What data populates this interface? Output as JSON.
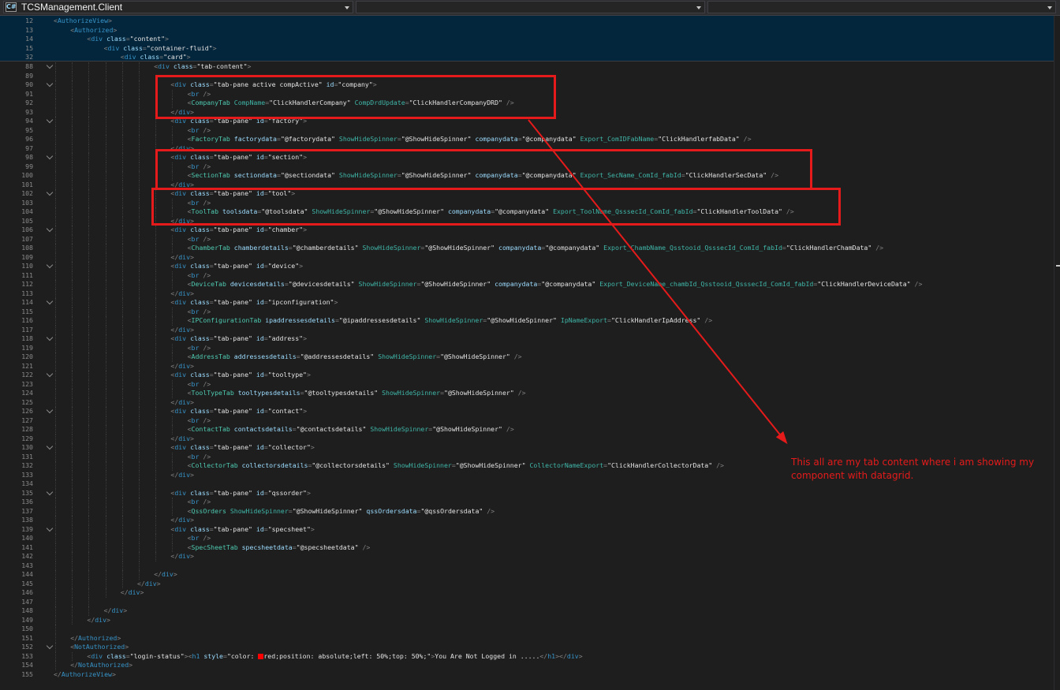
{
  "window": {
    "project_dropdown": "TCSManagement.Client",
    "project_icon": "C#"
  },
  "sticky_lines": [
    {
      "num": "12",
      "text": "<AuthorizeView>"
    },
    {
      "num": "13",
      "text": "<Authorized>"
    },
    {
      "num": "14",
      "text": "<div class=\"content\">"
    },
    {
      "num": "15",
      "text": "<div class=\"container-fluid\">"
    },
    {
      "num": "32",
      "text": "<div class=\"card\">"
    }
  ],
  "code_lines": [
    {
      "num": "88",
      "text": "<div class=\"tab-content\">"
    },
    {
      "num": "89",
      "text": ""
    },
    {
      "num": "90",
      "text": "<div class=\"tab-pane active compActive\" id=\"company\">"
    },
    {
      "num": "91",
      "text": "<br />"
    },
    {
      "num": "92",
      "text": "<CompanyTab CompName=\"ClickHandlerCompany\" CompDrdUpdate=\"ClickHandlerCompanyDRD\" />"
    },
    {
      "num": "93",
      "text": "</div>"
    },
    {
      "num": "94",
      "text": "<div class=\"tab-pane\" id=\"factory\">"
    },
    {
      "num": "95",
      "text": "<br />"
    },
    {
      "num": "96",
      "text": "<FactoryTab factorydata=\"@factorydata\" ShowHideSpinner=\"@ShowHideSpinner\" companydata=\"@companydata\" Export_ComIDFabName=\"ClickHandlerfabData\" />"
    },
    {
      "num": "97",
      "text": "</div>"
    },
    {
      "num": "98",
      "text": "<div class=\"tab-pane\" id=\"section\">"
    },
    {
      "num": "99",
      "text": "<br />"
    },
    {
      "num": "100",
      "text": "<SectionTab sectiondata=\"@sectiondata\" ShowHideSpinner=\"@ShowHideSpinner\" companydata=\"@companydata\" Export_SecName_ComId_fabId=\"ClickHandlerSecData\" />"
    },
    {
      "num": "101",
      "text": "</div>"
    },
    {
      "num": "102",
      "text": "<div class=\"tab-pane\" id=\"tool\">"
    },
    {
      "num": "103",
      "text": "<br />"
    },
    {
      "num": "104",
      "text": "<ToolTab toolsdata=\"@toolsdata\" ShowHideSpinner=\"@ShowHideSpinner\" companydata=\"@companydata\" Export_ToolName_QsssecId_ComId_fabId=\"ClickHandlerToolData\" />"
    },
    {
      "num": "105",
      "text": "</div>"
    },
    {
      "num": "106",
      "text": "<div class=\"tab-pane\" id=\"chamber\">"
    },
    {
      "num": "107",
      "text": "<br />"
    },
    {
      "num": "108",
      "text": "<ChamberTab chamberdetails=\"@chamberdetails\" ShowHideSpinner=\"@ShowHideSpinner\" companydata=\"@companydata\" Export_ChambName_Qsstooid_QsssecId_ComId_fabId=\"ClickHandlerChamData\" />"
    },
    {
      "num": "109",
      "text": "</div>"
    },
    {
      "num": "110",
      "text": "<div class=\"tab-pane\" id=\"device\">"
    },
    {
      "num": "111",
      "text": "<br />"
    },
    {
      "num": "112",
      "text": "<DeviceTab devicesdetails=\"@devicesdetails\" ShowHideSpinner=\"@ShowHideSpinner\" companydata=\"@companydata\" Export_DeviceName_chambId_Qsstooid_QsssecId_ComId_fabId=\"ClickHandlerDeviceData\" />"
    },
    {
      "num": "113",
      "text": "</div>"
    },
    {
      "num": "114",
      "text": "<div class=\"tab-pane\" id=\"ipconfiguration\">"
    },
    {
      "num": "115",
      "text": "<br />"
    },
    {
      "num": "116",
      "text": "<IPConfigurationTab ipaddressesdetails=\"@ipaddressesdetails\" ShowHideSpinner=\"@ShowHideSpinner\" IpNameExport=\"ClickHandlerIpAddress\" />"
    },
    {
      "num": "117",
      "text": "</div>"
    },
    {
      "num": "118",
      "text": "<div class=\"tab-pane\" id=\"address\">"
    },
    {
      "num": "119",
      "text": "<br />"
    },
    {
      "num": "120",
      "text": "<AddressTab addressesdetails=\"@addressesdetails\" ShowHideSpinner=\"@ShowHideSpinner\" />"
    },
    {
      "num": "121",
      "text": "</div>"
    },
    {
      "num": "122",
      "text": "<div class=\"tab-pane\" id=\"tooltype\">"
    },
    {
      "num": "123",
      "text": "<br />"
    },
    {
      "num": "124",
      "text": "<ToolTypeTab tooltypesdetails=\"@tooltypesdetails\" ShowHideSpinner=\"@ShowHideSpinner\" />"
    },
    {
      "num": "125",
      "text": "</div>"
    },
    {
      "num": "126",
      "text": "<div class=\"tab-pane\" id=\"contact\">"
    },
    {
      "num": "127",
      "text": "<br />"
    },
    {
      "num": "128",
      "text": "<ContactTab contactsdetails=\"@contactsdetails\" ShowHideSpinner=\"@ShowHideSpinner\" />"
    },
    {
      "num": "129",
      "text": "</div>"
    },
    {
      "num": "130",
      "text": "<div class=\"tab-pane\" id=\"collector\">"
    },
    {
      "num": "131",
      "text": "<br />"
    },
    {
      "num": "132",
      "text": "<CollectorTab collectorsdetails=\"@collectorsdetails\" ShowHideSpinner=\"@ShowHideSpinner\" CollectorNameExport=\"ClickHandlerCollectorData\" />"
    },
    {
      "num": "133",
      "text": "</div>"
    },
    {
      "num": "134",
      "text": ""
    },
    {
      "num": "135",
      "text": "<div class=\"tab-pane\" id=\"qssorder\">"
    },
    {
      "num": "136",
      "text": "<br />"
    },
    {
      "num": "137",
      "text": "<QssOrders ShowHideSpinner=\"@ShowHideSpinner\" qssOrdersdata=\"@qssOrdersdata\" />"
    },
    {
      "num": "138",
      "text": "</div>"
    },
    {
      "num": "139",
      "text": "<div class=\"tab-pane\" id=\"specsheet\">"
    },
    {
      "num": "140",
      "text": "<br />"
    },
    {
      "num": "141",
      "text": "<SpecSheetTab specsheetdata=\"@specsheetdata\" />"
    },
    {
      "num": "142",
      "text": "</div>"
    },
    {
      "num": "143",
      "text": ""
    },
    {
      "num": "144",
      "text": "</div>"
    },
    {
      "num": "145",
      "text": "</div>"
    },
    {
      "num": "146",
      "text": "</div>"
    },
    {
      "num": "147",
      "text": ""
    },
    {
      "num": "148",
      "text": "</div>"
    },
    {
      "num": "149",
      "text": "</div>"
    },
    {
      "num": "150",
      "text": ""
    },
    {
      "num": "151",
      "text": "</Authorized>"
    },
    {
      "num": "152",
      "text": "<NotAuthorized>"
    },
    {
      "num": "153",
      "text": "<div class=\"login-status\"><h1 style=\"color: red;position: absolute;left: 50%;top: 50%;\">You Are Not Logged in .....</h1></div>"
    },
    {
      "num": "154",
      "text": "</NotAuthorized>"
    },
    {
      "num": "155",
      "text": "</AuthorizeView>"
    }
  ],
  "annotation": {
    "note": "This all are my tab content where i am showing my component with datagrid.",
    "color": "#e51b1b"
  },
  "colors": {
    "tag": "#3794c9",
    "attribute": "#9cdcfe",
    "component": "#4ec9b0",
    "background": "#1e1e1e",
    "sticky_background": "#04263c"
  }
}
